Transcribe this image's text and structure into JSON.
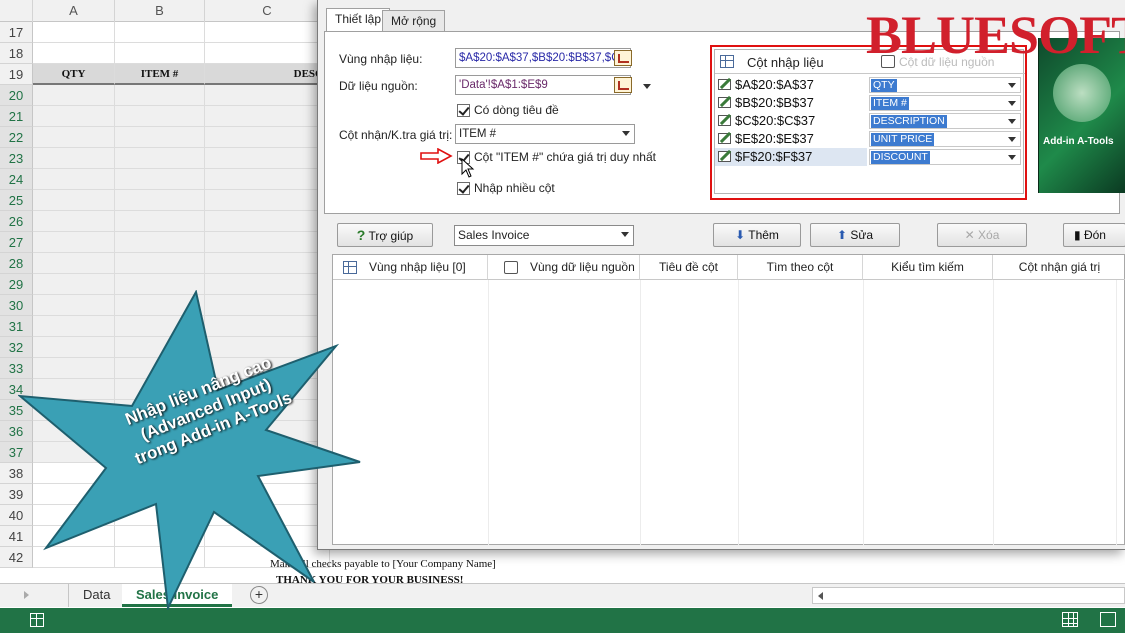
{
  "excel": {
    "columns": [
      "A",
      "B",
      "C"
    ],
    "rows": [
      "17",
      "18",
      "19",
      "20",
      "21",
      "22",
      "23",
      "24",
      "25",
      "26",
      "27",
      "28",
      "29",
      "30",
      "31",
      "32",
      "33",
      "34",
      "35",
      "36",
      "37",
      "38",
      "39",
      "40",
      "41",
      "42"
    ],
    "table_headers": [
      "QTY",
      "ITEM #",
      "DESC"
    ],
    "footer_line1": "Make all checks payable to [Your Company Name]",
    "footer_line2": "THANK YOU FOR YOUR BUSINESS!",
    "sheet_tabs": [
      "Data",
      "Sales Invoice"
    ],
    "add_sheet": "+"
  },
  "dialog": {
    "tabs": [
      "Thiết lập",
      "Mở rộng"
    ],
    "labels": {
      "input_range": "Vùng nhập liệu:",
      "source_data": "Dữ liệu nguồn:",
      "check_column": "Cột nhận/K.tra giá trị:"
    },
    "values": {
      "input_range": "$A$20:$A$37,$B$20:$B$37,$C$",
      "source_data": "'Data'!$A$1:$E$9",
      "check_column": "ITEM #"
    },
    "checkboxes": {
      "has_header": "Có dòng tiêu đề",
      "unique": "Cột \"ITEM #\" chứa giá trị duy nhất",
      "multi": "Nhập nhiều cột"
    },
    "column_list": {
      "header": "Cột nhập liệu",
      "header_right": "Cột dữ liệu nguồn",
      "rows": [
        {
          "range": "$A$20:$A$37",
          "source": "QTY"
        },
        {
          "range": "$B$20:$B$37",
          "source": "ITEM #"
        },
        {
          "range": "$C$20:$C$37",
          "source": "DESCRIPTION"
        },
        {
          "range": "$E$20:$E$37",
          "source": "UNIT PRICE"
        },
        {
          "range": "$F$20:$F$37",
          "source": "DISCOUNT"
        }
      ]
    },
    "toolbar": {
      "help": "Trợ giúp",
      "preset": "Sales Invoice",
      "add": "Thêm",
      "edit": "Sửa",
      "delete": "Xóa",
      "close": "Đón"
    },
    "table_headers": [
      "Vùng nhập liệu [0]",
      "Vùng dữ liệu nguồn",
      "Tiêu đề cột",
      "Tìm theo cột",
      "Kiểu tìm kiếm",
      "Cột nhận giá trị"
    ]
  },
  "branding": {
    "brand": "BLUESOFTS",
    "product": "Add-in A-Tools"
  },
  "callout": {
    "line1": "Nhập liệu nâng cao",
    "line2": "(Advanced Input)",
    "line3": "trong Add-in A-Tools"
  },
  "colors": {
    "excel_green": "#217346",
    "highlight_red": "#e01010",
    "brand_red": "#d1202c",
    "burst_teal": "#3aa0b5"
  }
}
